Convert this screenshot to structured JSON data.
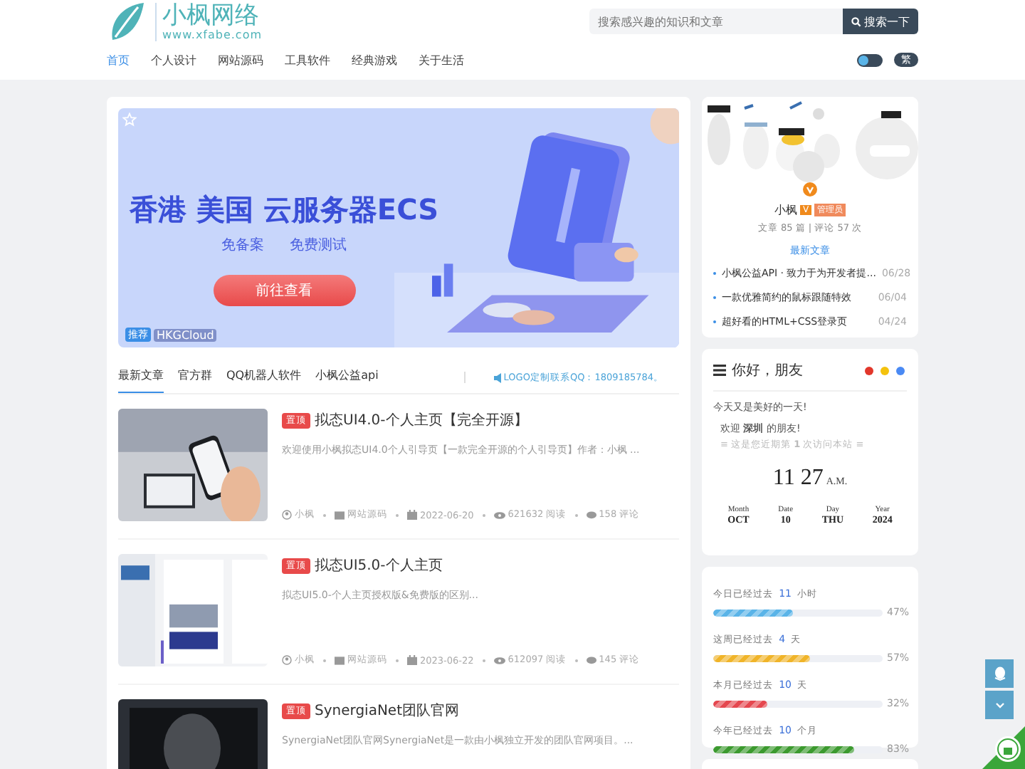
{
  "header": {
    "logo_title": "小枫网络",
    "logo_url": "www.xfabe.com",
    "search": {
      "placeholder": "搜索感兴趣的知识和文章"
    },
    "search_button": "搜索一下",
    "nav": [
      {
        "label": "首页",
        "selected": true
      },
      {
        "label": "个人设计",
        "selected": false
      },
      {
        "label": "网站源码",
        "selected": false
      },
      {
        "label": "工具软件",
        "selected": false
      },
      {
        "label": "经典游戏",
        "selected": false
      },
      {
        "label": "关于生活",
        "selected": false
      }
    ],
    "theme_toggle": {
      "on": false
    },
    "lang_button": "繁"
  },
  "banner": {
    "headline": "香港 美国 云服务器ECS",
    "features": [
      "免备案",
      "免费测试"
    ],
    "cta": "前往查看",
    "tag": "推荐",
    "source": "HKGCloud"
  },
  "tabs": [
    {
      "label": "最新文章",
      "selected": true
    },
    {
      "label": "官方群",
      "selected": false
    },
    {
      "label": "QQ机器人软件",
      "selected": false
    },
    {
      "label": "小枫公益api",
      "selected": false
    }
  ],
  "notice": "LOGO定制联系QQ：1809185784。",
  "articles": [
    {
      "badge": "置顶",
      "title": "拟态UI4.0-个人主页【完全开源】",
      "excerpt": "欢迎使用小枫拟态UI4.0个人引导页【一款完全开源的个人引导页】作者：小枫 ...",
      "author": "小枫",
      "category": "网站源码",
      "date": "2022-06-20",
      "views": "621632 阅读",
      "comments": "158 评论"
    },
    {
      "badge": "置顶",
      "title": "拟态UI5.0-个人主页",
      "excerpt": "拟态UI5.0-个人主页授权版&免费版的区别...",
      "author": "小枫",
      "category": "网站源码",
      "date": "2023-06-22",
      "views": "612097 阅读",
      "comments": "145 评论"
    },
    {
      "badge": "置顶",
      "title": "SynergiaNet团队官网",
      "excerpt": "SynergiaNet团队官网SynergiaNet是一款由小枫独立开发的团队官网项目。..."
    }
  ],
  "profile": {
    "name": "小枫",
    "verified": "V",
    "role": "管理员",
    "stats": "文章 85 篇 | 评论 57 次",
    "section": "最新文章",
    "posts": [
      {
        "title": "小枫公益API · 致力于为开发者提...",
        "date": "06/28"
      },
      {
        "title": "一款优雅简约的鼠标跟随特效",
        "date": "06/04"
      },
      {
        "title": "超好看的HTML+CSS登录页",
        "date": "04/24"
      }
    ]
  },
  "greeting": {
    "title": "你好，朋友",
    "line": "今天又是美好的一天!",
    "welcome": "欢迎 **深圳** 的朋友!",
    "visits": "≡ 这是您近期第 **1** 次访问本站 ≡",
    "time": "11 27",
    "meridiem": "A.M.",
    "date_parts": [
      {
        "label": "Month",
        "value": "OCT"
      },
      {
        "label": "Date",
        "value": "10"
      },
      {
        "label": "Day",
        "value": "THU"
      },
      {
        "label": "Year",
        "value": "2024"
      }
    ]
  },
  "progress": [
    {
      "prefix": "今日已经过去",
      "value": "11",
      "unit": "小时",
      "level": 0.47,
      "percent": "47%",
      "color": "#5ab4e8"
    },
    {
      "prefix": "这周已经过去",
      "value": "4",
      "unit": "天",
      "level": 0.57,
      "percent": "57%",
      "color": "#f0b429"
    },
    {
      "prefix": "本月已经过去",
      "value": "10",
      "unit": "天",
      "level": 0.32,
      "percent": "32%",
      "color": "#e5474f"
    },
    {
      "prefix": "今年已经过去",
      "value": "10",
      "unit": "个月",
      "level": 0.83,
      "percent": "83%",
      "color": "#3c9a2f"
    }
  ]
}
